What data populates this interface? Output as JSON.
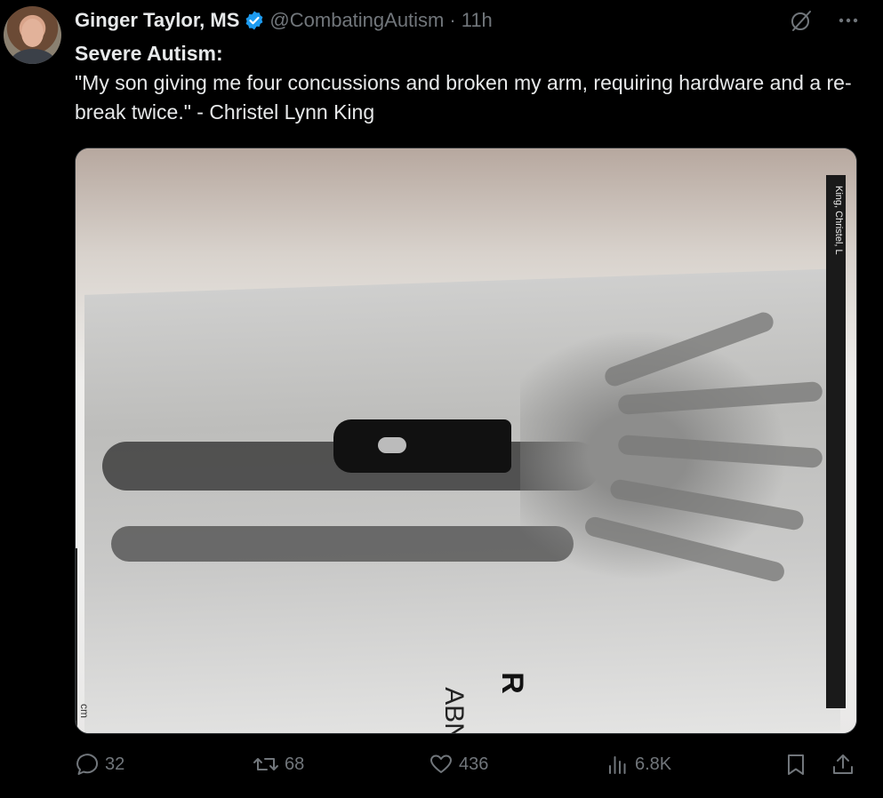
{
  "tweet": {
    "author_name": "Ginger Taylor, MS",
    "handle": "@CombatingAutism",
    "separator": "·",
    "time": "11h",
    "heading": "Severe Autism:",
    "body": "\"My son giving me four concussions and broken my arm, requiring hardware and a re-break twice.\" - Christel Lynn King"
  },
  "media": {
    "patient_label": "King, Christel, L",
    "orientation_marker": "R",
    "label_abn": "ABN",
    "ruler_unit": "cm"
  },
  "actions": {
    "replies": "32",
    "reposts": "68",
    "likes": "436",
    "views": "6.8K"
  },
  "icons": [
    "verified-badge-icon",
    "grok-slash-icon",
    "more-icon",
    "reply-icon",
    "repost-icon",
    "like-icon",
    "views-icon",
    "bookmark-icon",
    "share-icon"
  ],
  "colors": {
    "verified": "#1d9bf0",
    "muted": "#71767b",
    "text": "#e7e9ea",
    "background": "#000000"
  }
}
